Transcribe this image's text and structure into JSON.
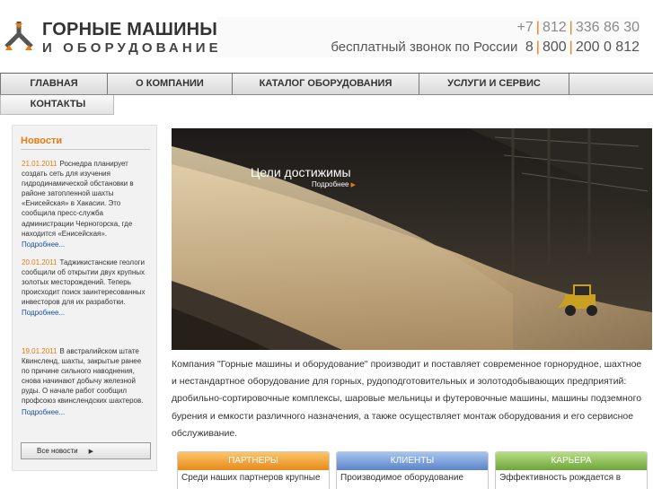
{
  "header": {
    "logo_line1": "ГОРНЫЕ МАШИНЫ",
    "logo_line2": "И ОБОРУДОВАНИЕ",
    "phone1": {
      "code": "+7",
      "area": "812",
      "number": "336 86 30"
    },
    "phone2": {
      "label": "бесплатный звонок по России",
      "code": "8",
      "area": "800",
      "number": "200 0 812"
    }
  },
  "nav": {
    "items": [
      {
        "label": "ГЛАВНАЯ"
      },
      {
        "label": "О КОМПАНИИ"
      },
      {
        "label": "КАТАЛОГ ОБОРУДОВАНИЯ"
      },
      {
        "label": "УСЛУГИ И СЕРВИС"
      },
      {
        "label": ""
      }
    ],
    "second_row": {
      "label": "КОНТАКТЫ"
    }
  },
  "news": {
    "title": "Новости",
    "items": [
      {
        "date": "21.01.2011",
        "text": "Роснедра планирует создать сеть для изучения гидродинамической обстановки в районе затопленной шахты «Енисейская» в Хакасии. Это сообщила пресс-служба администрации Черногорска, где находится «Енисейская».",
        "more": "Подробнее..."
      },
      {
        "date": "20.01.2011",
        "text": "Таджикистанские геологи сообщили об открытии двух крупных золотых месторождений. Теперь происходит поиск заинтересованных инвесторов для их разработки.",
        "more": "Подробнее..."
      },
      {
        "date": "19.01.2011",
        "text": "В австралийском штате Квинсленд, шахты, закрытые ранее по причине сильного наводнения, снова начинают добычу железной руды. О начале работ сообщил профсоюз квинслендских шахтеров.",
        "more": "Подробнее..."
      }
    ],
    "all_label": "Все новости"
  },
  "hero": {
    "title": "Цели достижимы",
    "more": "Подробнее"
  },
  "description": "Компания \"Горные машины и оборудование\" производит и поставляет современное горнорудное, шахтное и нестандартное оборудование для горных, рудоподготовительных и золотодобывающих предприятий: дробильно-сортировочные комплексы, шаровые мельницы и футеровочные машины, машины подземного бурения и емкости различного назначения, а также осуществляет монтаж оборудования и его сервисное обслуживание.",
  "boxes": [
    {
      "title": "ПАРТНЕРЫ",
      "text": "Среди наших партнеров крупные"
    },
    {
      "title": "КЛИЕНТЫ",
      "text": "Производимое оборудование"
    },
    {
      "title": "КАРЬЕРА",
      "text": "Эффективность рождается в"
    }
  ],
  "colors": {
    "accent": "#e87b12",
    "link": "#1a4fa8",
    "partners": "#e8891a",
    "clients": "#5b84c8",
    "career": "#6ea53a"
  }
}
